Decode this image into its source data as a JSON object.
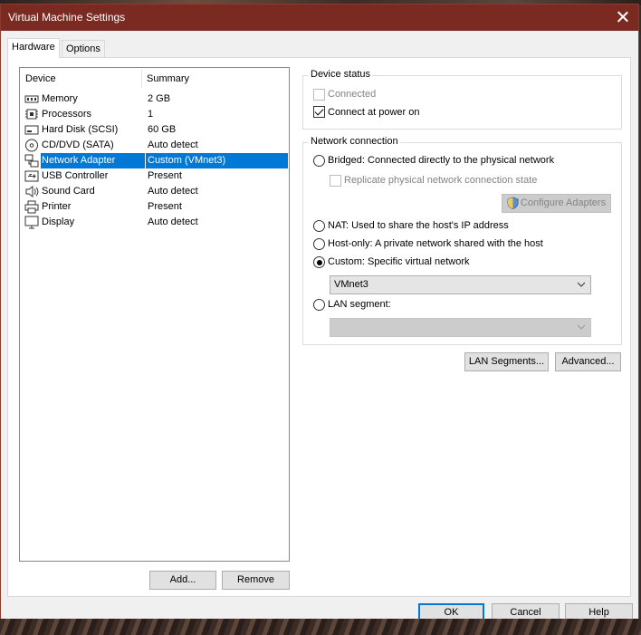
{
  "window": {
    "title": "Virtual Machine Settings"
  },
  "tabs": [
    {
      "label": "Hardware"
    },
    {
      "label": "Options"
    }
  ],
  "device_list": {
    "headers": {
      "device": "Device",
      "summary": "Summary"
    },
    "rows": [
      {
        "name": "Memory",
        "summary": "2 GB",
        "icon": "memory-icon"
      },
      {
        "name": "Processors",
        "summary": "1",
        "icon": "processor-icon"
      },
      {
        "name": "Hard Disk (SCSI)",
        "summary": "60 GB",
        "icon": "hard-disk-icon"
      },
      {
        "name": "CD/DVD (SATA)",
        "summary": "Auto detect",
        "icon": "cd-dvd-icon"
      },
      {
        "name": "Network Adapter",
        "summary": "Custom (VMnet3)",
        "icon": "network-adapter-icon",
        "selected": true
      },
      {
        "name": "USB Controller",
        "summary": "Present",
        "icon": "usb-icon"
      },
      {
        "name": "Sound Card",
        "summary": "Auto detect",
        "icon": "speaker-icon"
      },
      {
        "name": "Printer",
        "summary": "Present",
        "icon": "printer-icon"
      },
      {
        "name": "Display",
        "summary": "Auto detect",
        "icon": "display-icon"
      }
    ],
    "add_label": "Add...",
    "remove_label": "Remove"
  },
  "device_status": {
    "label": "Device status",
    "connected": {
      "label": "Connected",
      "checked": false,
      "disabled": true
    },
    "connect_power_on": {
      "label": "Connect at power on",
      "checked": true
    }
  },
  "network_connection": {
    "label": "Network connection",
    "bridged": {
      "label": "Bridged: Connected directly to the physical network",
      "selected": false
    },
    "replicate": {
      "label": "Replicate physical network connection state",
      "checked": false,
      "disabled": true
    },
    "configure_adapters_label": "Configure Adapters",
    "nat": {
      "label": "NAT: Used to share the host's IP address",
      "selected": false
    },
    "host_only": {
      "label": "Host-only: A private network shared with the host",
      "selected": false
    },
    "custom": {
      "label": "Custom: Specific virtual network",
      "selected": true
    },
    "custom_value": "VMnet3",
    "lan_segment": {
      "label": "LAN segment:",
      "selected": false
    },
    "lan_segment_value": ""
  },
  "buttons": {
    "lan_segments": "LAN Segments...",
    "advanced": "Advanced...",
    "ok": "OK",
    "cancel": "Cancel",
    "help": "Help"
  },
  "colors": {
    "titlebar": "#7a2a21",
    "selection": "#0078d7",
    "default_button_border": "#0078d7"
  }
}
